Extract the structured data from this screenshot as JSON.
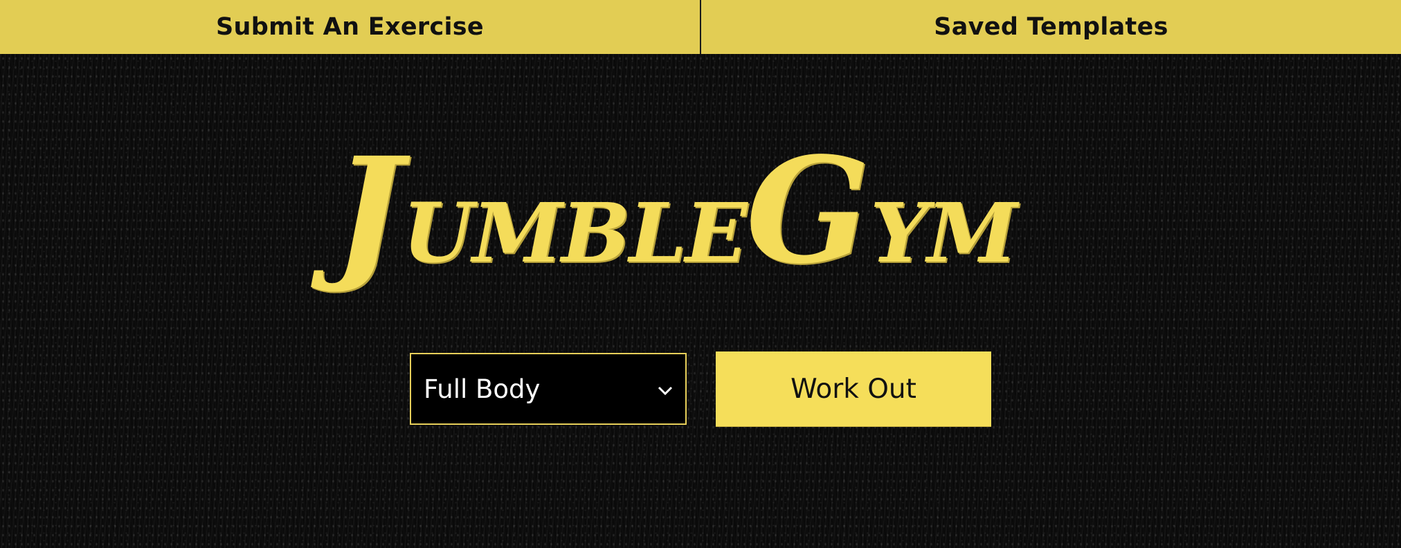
{
  "nav": {
    "items": [
      {
        "label": "Submit An Exercise"
      },
      {
        "label": "Saved Templates"
      }
    ]
  },
  "logo": {
    "text": "JumbleGym",
    "part1_cap": "J",
    "part1_rest": "UMBLE",
    "part2_cap": "G",
    "part2_rest": "YM"
  },
  "controls": {
    "body_part_select": {
      "selected": "Full Body",
      "icon": "chevron-down-icon"
    },
    "workout_button_label": "Work Out"
  },
  "colors": {
    "accent_yellow": "#f5de5a",
    "nav_yellow": "#e2cd54",
    "background": "#0d0d0d"
  }
}
